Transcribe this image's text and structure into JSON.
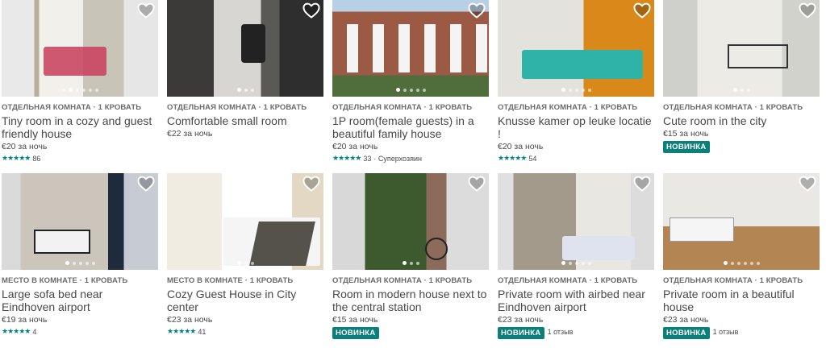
{
  "colors": {
    "accent": "#008489",
    "badge": "#0b7f7a",
    "text": "#484848",
    "meta": "#6b6b6b"
  },
  "listings": [
    {
      "type": "ОТДЕЛЬНАЯ КОМНАТА · 1 КРОВАТЬ",
      "title": "Tiny room in a cozy and guest friendly house",
      "price": "€20 за ночь",
      "stars": "★★★★★",
      "reviews": "86",
      "extra": "",
      "badge": "",
      "dots": 6,
      "active_dot": 1
    },
    {
      "type": "ОТДЕЛЬНАЯ КОМНАТА · 1 КРОВАТЬ",
      "title": "Comfortable small room",
      "price": "€22 за ночь",
      "stars": "",
      "reviews": "",
      "extra": "",
      "badge": "",
      "dots": 3,
      "active_dot": 0
    },
    {
      "type": "ОТДЕЛЬНАЯ КОМНАТА · 1 КРОВАТЬ",
      "title": "1P room(female guests) in a beautiful family house",
      "price": "€20 за ночь",
      "stars": "★★★★★",
      "reviews": "33",
      "extra": "· Суперхозяин",
      "badge": "",
      "dots": 5,
      "active_dot": 0
    },
    {
      "type": "ОТДЕЛЬНАЯ КОМНАТА · 1 КРОВАТЬ",
      "title": "Knusse kamer op leuke locatie !",
      "price": "€20 за ночь",
      "stars": "★★★★★",
      "reviews": "54",
      "extra": "",
      "badge": "",
      "dots": 5,
      "active_dot": 0
    },
    {
      "type": "ОТДЕЛЬНАЯ КОМНАТА · 1 КРОВАТЬ",
      "title": "Cute room in the city",
      "price": "€15 за ночь",
      "stars": "",
      "reviews": "",
      "extra": "",
      "badge": "НОВИНКА",
      "dots": 3,
      "active_dot": 0
    },
    {
      "type": "МЕСТО В КОМНАТЕ · 1 КРОВАТЬ",
      "title": "Large sofa bed near Eindhoven airport",
      "price": "€19 за ночь",
      "stars": "★★★★★",
      "reviews": "4",
      "extra": "",
      "badge": "",
      "dots": 5,
      "active_dot": 0
    },
    {
      "type": "МЕСТО В КОМНАТЕ · 1 КРОВАТЬ",
      "title": "Cozy Guest House in City center",
      "price": "€23 за ночь",
      "stars": "★★★★★",
      "reviews": "41",
      "extra": "",
      "badge": "",
      "dots": 3,
      "active_dot": 0
    },
    {
      "type": "ОТДЕЛЬНАЯ КОМНАТА · 1 КРОВАТЬ",
      "title": "Room in modern house next to the central station",
      "price": "€15 за ночь",
      "stars": "",
      "reviews": "",
      "extra": "",
      "badge": "НОВИНКА",
      "dots": 3,
      "active_dot": 0
    },
    {
      "type": "ОТДЕЛЬНАЯ КОМНАТА · 1 КРОВАТЬ",
      "title": "Private room with airbed near Eindhoven airport",
      "price": "€23 за ночь",
      "stars": "",
      "reviews": "",
      "extra": "1 отзыв",
      "badge": "НОВИНКА",
      "dots": 5,
      "active_dot": 0
    },
    {
      "type": "ОТДЕЛЬНАЯ КОМНАТА · 1 КРОВАТЬ",
      "title": "Private room in a beautiful house",
      "price": "€23 за ночь",
      "stars": "",
      "reviews": "",
      "extra": "1 отзыв",
      "badge": "НОВИНКА",
      "dots": 6,
      "active_dot": 0
    }
  ]
}
